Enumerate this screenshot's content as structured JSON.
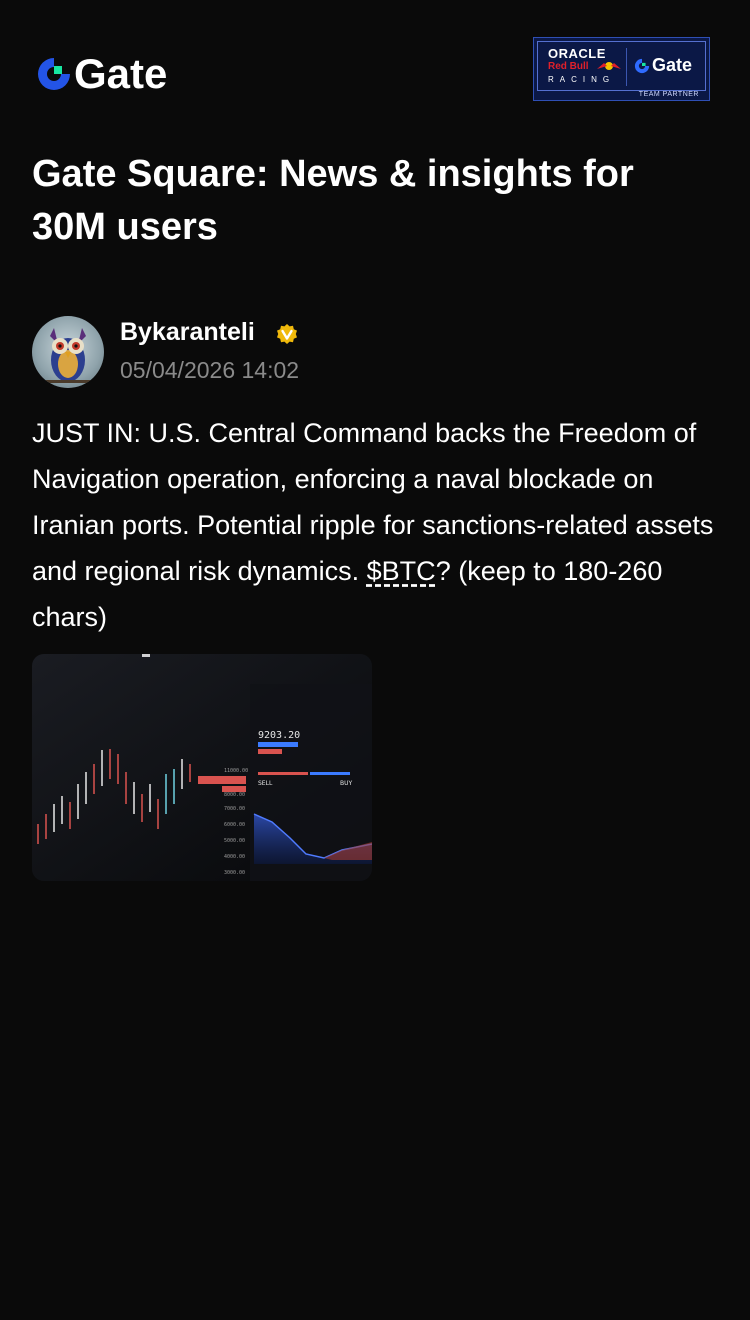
{
  "header": {
    "logo_text": "Gate",
    "partner_badge": {
      "line1": "ORACLE",
      "line2": "Red Bull",
      "line3": "RACING",
      "brand": "Gate",
      "caption": "TEAM PARTNER"
    }
  },
  "page_title": "Gate Square: News & insights for 30M users",
  "post": {
    "author": {
      "name": "Bykaranteli",
      "verified": true,
      "timestamp": "05/04/2026 14:02"
    },
    "body_main": "JUST IN: U.S. Central Command backs the Freedom of Navigation operation, enforcing a naval blockade on Iranian ports. Potential ripple for sanctions-related assets and regional risk dynamics. ",
    "ticker": "$BTC",
    "body_tail": "? (keep to 180-260 chars)",
    "image_labels": {
      "price": "9203.20",
      "sell": "SELL",
      "buy": "BUY"
    }
  },
  "colors": {
    "background": "#0a0a0a",
    "brand_blue": "#2354e6",
    "brand_green": "#17e6a1",
    "verified_gold": "#f0b90b",
    "muted_text": "#8a8a8a"
  },
  "icons": [
    "gate-logo-icon",
    "verified-badge-icon",
    "owl-avatar"
  ]
}
